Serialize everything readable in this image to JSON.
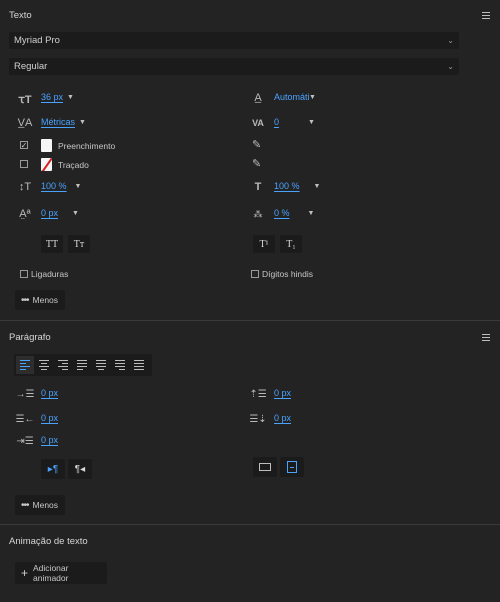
{
  "texto": {
    "title": "Texto",
    "font_family": "Myriad Pro",
    "font_style": "Regular",
    "font_size": "36 px",
    "leading": "Automático",
    "kerning": "Métricas",
    "tracking": "0",
    "fill_label": "Preenchimento",
    "stroke_label": "Traçado",
    "vertical_scale": "100 %",
    "horizontal_scale": "100 %",
    "baseline_shift": "0 px",
    "tsume": "0 %",
    "allcaps_btn": "TT",
    "smallcaps_btn": "Tт",
    "superscript_btn": "T¹",
    "subscript_btn": "T₁",
    "ligatures_label": "Ligaduras",
    "hindi_digits_label": "Dígitos hindis",
    "more_label": "Menos"
  },
  "paragrafo": {
    "title": "Parágrafo",
    "indent_left": "0 px",
    "indent_right": "0 px",
    "indent_first": "0 px",
    "space_before": "0 px",
    "space_after": "0 px",
    "more_label": "Menos"
  },
  "animacao": {
    "title": "Animação de texto",
    "add_button": "Adicionar animador"
  }
}
